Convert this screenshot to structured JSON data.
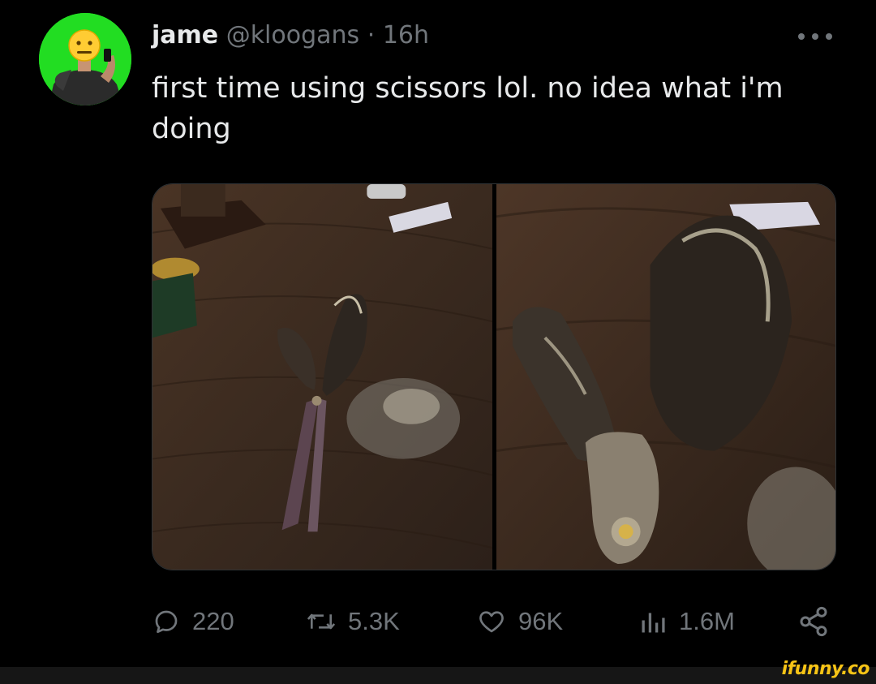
{
  "tweet": {
    "display_name": "jame",
    "handle": "@kloogans",
    "separator": "·",
    "time": "16h",
    "text": "first time using scissors lol. no idea what i'm doing"
  },
  "actions": {
    "replies": "220",
    "reposts": "5.3K",
    "likes": "96K",
    "views": "1.6M"
  },
  "icons": {
    "more": "more-horizontal-icon",
    "reply": "reply-icon",
    "repost": "repost-icon",
    "like": "heart-icon",
    "views": "bar-chart-icon",
    "share": "share-icon"
  },
  "colors": {
    "background": "#000000",
    "text_primary": "#e7e9ea",
    "text_secondary": "#71767b",
    "avatar_bg": "#22dd22",
    "watermark": "#f7c416"
  },
  "watermark": "ifunny.co"
}
